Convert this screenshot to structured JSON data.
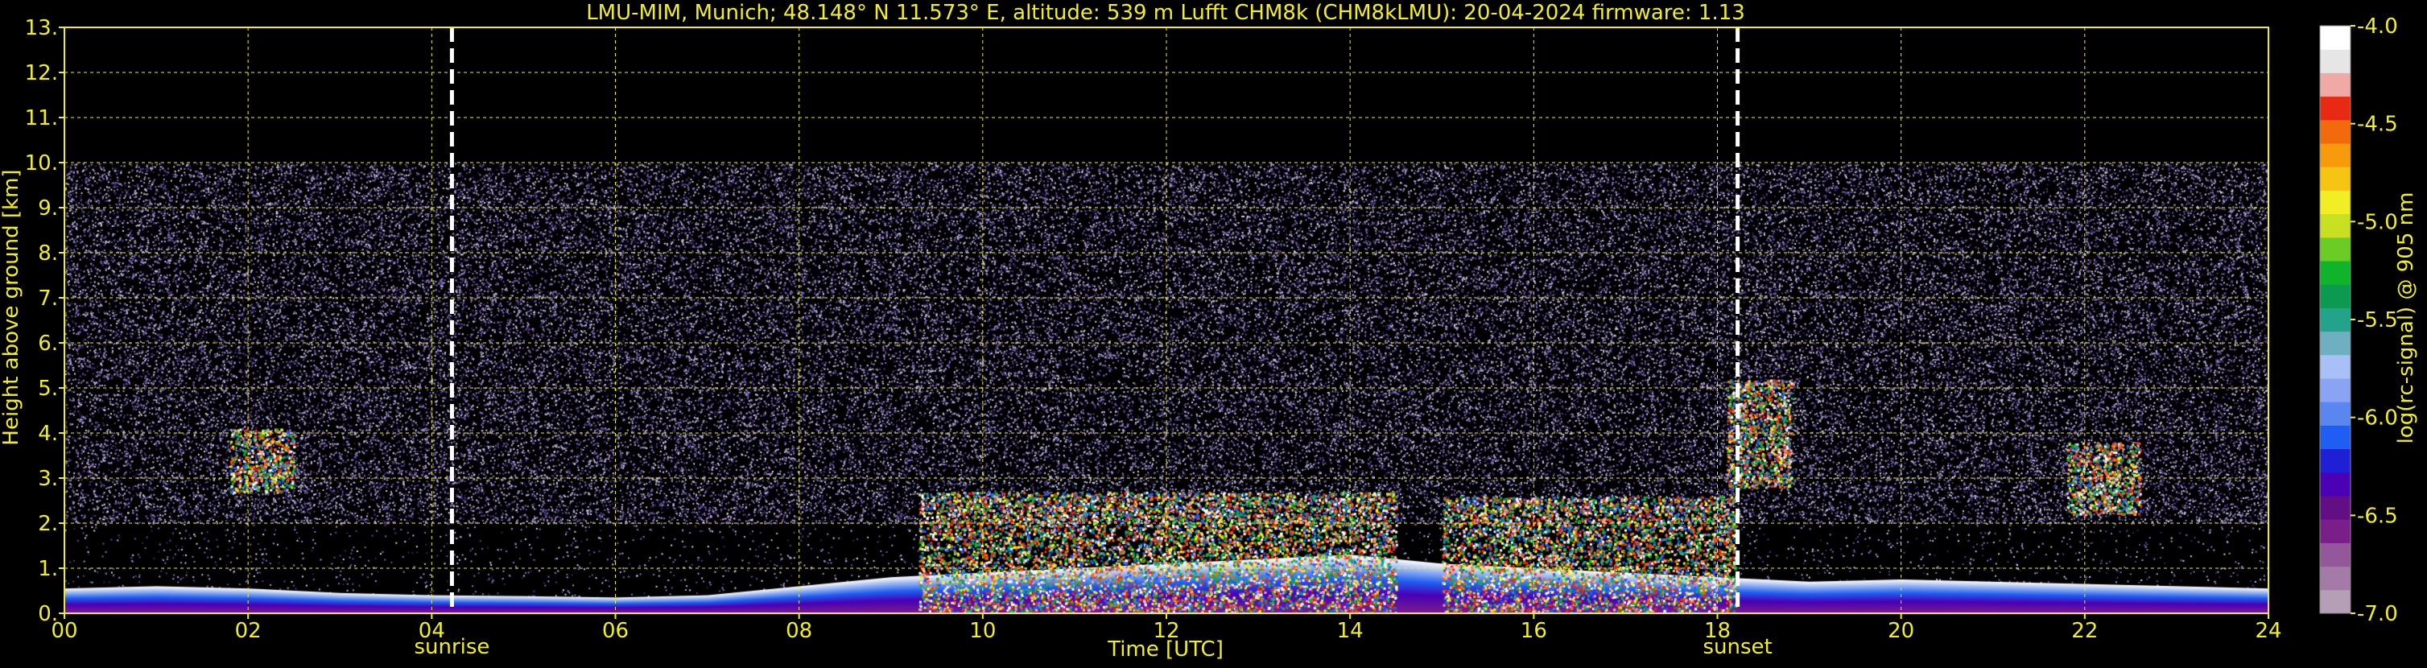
{
  "chart_data": {
    "type": "heatmap",
    "title": "LMU-MIM, Munich; 48.148° N 11.573° E, altitude: 539 m    Lufft CHM8k (CHM8kLMU): 20-04-2024    firmware: 1.13",
    "xlabel": "Time [UTC]",
    "ylabel": "Height above ground [km]",
    "xlim": [
      0,
      24
    ],
    "ylim": [
      0,
      13
    ],
    "x_ticks": [
      "00",
      "02",
      "04",
      "06",
      "08",
      "10",
      "12",
      "14",
      "16",
      "18",
      "20",
      "22",
      "24"
    ],
    "x_tick_values": [
      0,
      2,
      4,
      6,
      8,
      10,
      12,
      14,
      16,
      18,
      20,
      22,
      24
    ],
    "y_ticks": [
      "0.",
      "1.",
      "2.",
      "3.",
      "4.",
      "5.",
      "6.",
      "7.",
      "8.",
      "9.",
      "10.",
      "11.",
      "12.",
      "13."
    ],
    "y_tick_values": [
      0,
      1,
      2,
      3,
      4,
      5,
      6,
      7,
      8,
      9,
      10,
      11,
      12,
      13
    ],
    "grid": true,
    "data_max_height_km": 10,
    "events": [
      {
        "name": "sunrise",
        "time": 4.22
      },
      {
        "name": "sunset",
        "time": 18.22
      }
    ],
    "colorbar": {
      "label": "log(rc-signal) @ 905 nm",
      "min": -7.0,
      "max": -4.0,
      "ticks": [
        "-4.0",
        "-4.5",
        "-5.0",
        "-5.5",
        "-6.0",
        "-6.5",
        "-7.0"
      ],
      "tick_values": [
        -4.0,
        -4.5,
        -5.0,
        -5.5,
        -6.0,
        -6.5,
        -7.0
      ],
      "colors": [
        "#b49fb6",
        "#a47aa6",
        "#93579a",
        "#7a1f8a",
        "#620f86",
        "#4a00b5",
        "#1f1fd6",
        "#1f5ef2",
        "#5a86f0",
        "#8aa4f3",
        "#a8c0f5",
        "#6fb0c0",
        "#23a38c",
        "#0c9a50",
        "#0fb42a",
        "#6ccc26",
        "#c8e021",
        "#f2ee26",
        "#f6c514",
        "#f79b0c",
        "#f36a0c",
        "#e82a12",
        "#f1a9a6",
        "#e6e6e6",
        "#ffffff"
      ]
    },
    "features": [
      {
        "kind": "boundary_layer",
        "t_start": 0.0,
        "t_end": 24.0,
        "heights_km": [
          [
            0,
            0.55
          ],
          [
            1,
            0.6
          ],
          [
            2,
            0.55
          ],
          [
            3,
            0.45
          ],
          [
            4,
            0.4
          ],
          [
            5,
            0.38
          ],
          [
            6,
            0.35
          ],
          [
            7,
            0.4
          ],
          [
            8,
            0.6
          ],
          [
            9,
            0.8
          ],
          [
            10,
            0.9
          ],
          [
            11,
            1.0
          ],
          [
            12,
            1.1
          ],
          [
            13,
            1.2
          ],
          [
            14,
            1.3
          ],
          [
            15,
            1.1
          ],
          [
            16,
            1.0
          ],
          [
            17,
            0.9
          ],
          [
            18,
            0.8
          ],
          [
            19,
            0.7
          ],
          [
            20,
            0.75
          ],
          [
            21,
            0.7
          ],
          [
            22,
            0.65
          ],
          [
            23,
            0.6
          ],
          [
            24,
            0.55
          ]
        ]
      },
      {
        "kind": "cloud",
        "t_start": 9.3,
        "t_end": 14.5,
        "base_km": 0.0,
        "top_km": 2.7
      },
      {
        "kind": "cloud",
        "t_start": 15.0,
        "t_end": 18.2,
        "base_km": 0.0,
        "top_km": 2.6
      },
      {
        "kind": "cloud",
        "t_start": 18.1,
        "t_end": 18.8,
        "base_km": 2.8,
        "top_km": 5.2
      },
      {
        "kind": "cloud",
        "t_start": 21.8,
        "t_end": 22.6,
        "base_km": 2.2,
        "top_km": 3.8
      },
      {
        "kind": "cloud",
        "t_start": 1.8,
        "t_end": 2.5,
        "base_km": 2.7,
        "top_km": 4.1
      }
    ]
  }
}
